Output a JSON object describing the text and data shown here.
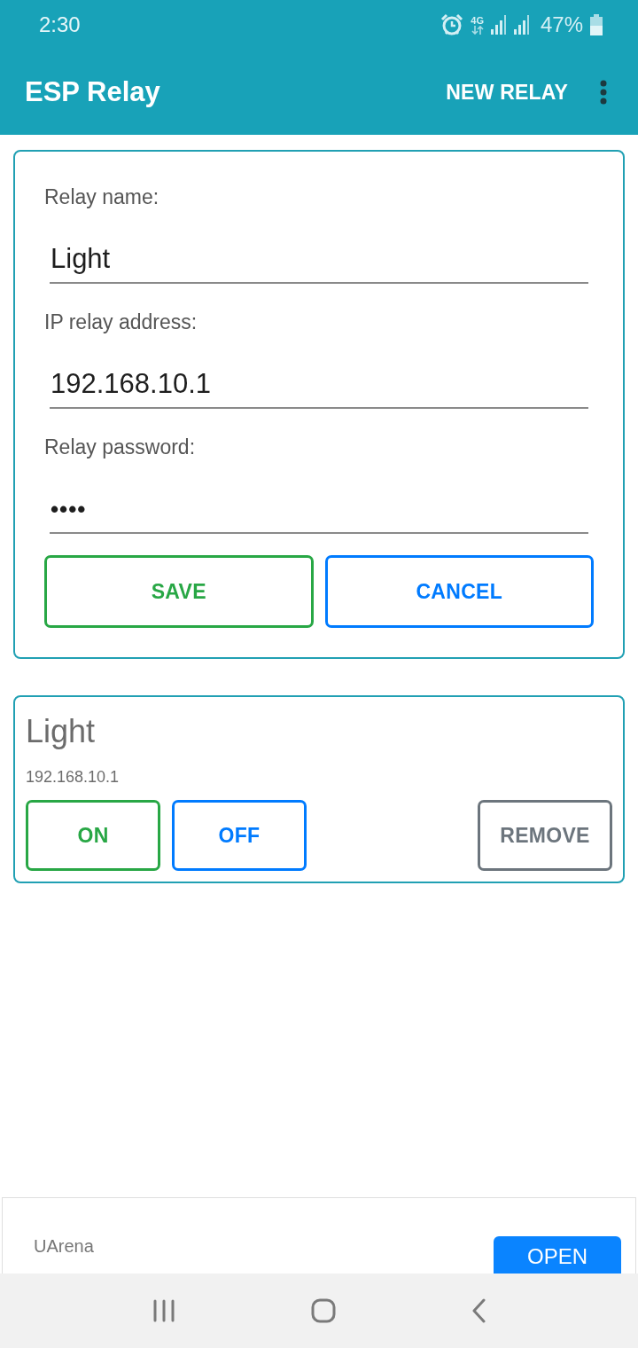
{
  "status_bar": {
    "time": "2:30",
    "network": "4G",
    "battery": "47%"
  },
  "app_bar": {
    "title": "ESP Relay",
    "action": "NEW RELAY"
  },
  "form": {
    "fields": [
      {
        "label": "Relay name:",
        "value": "Light",
        "kind": "text"
      },
      {
        "label": "IP relay address:",
        "value": "192.168.10.1",
        "kind": "text"
      },
      {
        "label": "Relay password:",
        "value": "••••",
        "kind": "password"
      }
    ],
    "buttons": [
      {
        "label": "SAVE",
        "color": "#28a745"
      },
      {
        "label": "CANCEL",
        "color": "#007bff"
      }
    ]
  },
  "relays": [
    {
      "name": "Light",
      "address": "192.168.10.1",
      "controls": [
        {
          "label": "ON",
          "color": "#28a745"
        },
        {
          "label": "OFF",
          "color": "#007bff"
        }
      ],
      "remove": {
        "label": "REMOVE",
        "color": "#6c757d"
      }
    }
  ],
  "ad": {
    "advertiser": "UArena",
    "button": "OPEN"
  }
}
